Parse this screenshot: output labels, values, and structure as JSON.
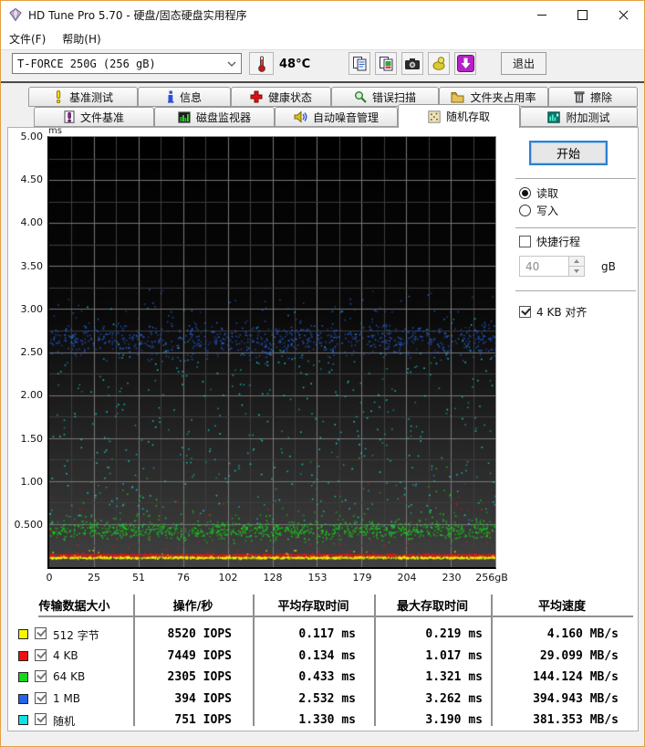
{
  "window": {
    "title": "HD Tune Pro 5.70 - 硬盘/固态硬盘实用程序"
  },
  "menu": {
    "file": "文件(F)",
    "help": "帮助(H)"
  },
  "toolbar": {
    "drive": "T-FORCE 250G (256 gB)",
    "temperature": "48°C",
    "exit": "退出"
  },
  "tabs": {
    "active": "随机存取",
    "row1": [
      {
        "label": "基准测试",
        "icon": "benchmark-icon"
      },
      {
        "label": "信息",
        "icon": "info-icon"
      },
      {
        "label": "健康状态",
        "icon": "health-icon"
      },
      {
        "label": "错误扫描",
        "icon": "error-scan-icon"
      },
      {
        "label": "文件夹占用率",
        "icon": "folder-usage-icon"
      },
      {
        "label": "擦除",
        "icon": "erase-icon"
      }
    ],
    "row2": [
      {
        "label": "文件基准",
        "icon": "file-benchmark-icon"
      },
      {
        "label": "磁盘监视器",
        "icon": "disk-monitor-icon"
      },
      {
        "label": "自动噪音管理",
        "icon": "aam-icon"
      },
      {
        "label": "随机存取",
        "icon": "random-access-icon"
      },
      {
        "label": "附加测试",
        "icon": "extra-tests-icon"
      }
    ]
  },
  "panel": {
    "start": "开始",
    "read": "读取",
    "write": "写入",
    "quick_range": "快捷行程",
    "quick_range_value": "40",
    "quick_range_unit": "gB",
    "align_4kb": "4 KB 对齐"
  },
  "chart_data": {
    "type": "scatter",
    "unit_label": "ms",
    "ylim": [
      0,
      5
    ],
    "xlim": [
      0,
      256
    ],
    "x_unit": "gB",
    "grid": "major+minor, dark background",
    "legend_position": "results-table-left-column",
    "ytick_labels": [
      "5.00",
      "4.50",
      "4.00",
      "3.50",
      "3.00",
      "2.50",
      "2.00",
      "1.50",
      "1.00",
      "0.500"
    ],
    "xtick_labels": [
      "0",
      "25",
      "51",
      "76",
      "102",
      "128",
      "153",
      "179",
      "204",
      "230",
      "256gB"
    ],
    "series": [
      {
        "name": "512 字节",
        "color": "#f6f600",
        "iops": 8520,
        "avg_ms": 0.117,
        "max_ms": 0.219,
        "speed_mbs": 4.16,
        "dist": "gauss",
        "band": [
          0.096,
          0.133
        ],
        "count": 1150,
        "outliers": {
          "range": [
            0.133,
            0.22
          ],
          "count": 25,
          "bias": 2
        }
      },
      {
        "name": "4 KB",
        "color": "#ee1212",
        "iops": 7449,
        "avg_ms": 0.134,
        "max_ms": 1.017,
        "speed_mbs": 29.099,
        "dist": "gauss",
        "band": [
          0.122,
          0.165
        ],
        "count": 1350,
        "outliers": {
          "range": [
            0.165,
            1.02
          ],
          "count": 55,
          "bias": 3
        }
      },
      {
        "name": "64 KB",
        "color": "#14d914",
        "iops": 2305,
        "avg_ms": 0.433,
        "max_ms": 1.321,
        "speed_mbs": 144.124,
        "dist": "gauss",
        "band": [
          0.27,
          0.6
        ],
        "count": 1050,
        "outliers": {
          "range": [
            0.6,
            1.32
          ],
          "count": 80,
          "bias": 2.5
        }
      },
      {
        "name": "1 MB",
        "color": "#2563e8",
        "iops": 394,
        "avg_ms": 2.532,
        "max_ms": 3.262,
        "speed_mbs": 394.943,
        "dist": "gauss",
        "band": [
          2.33,
          2.97
        ],
        "count": 850,
        "outliers": {
          "range": [
            2.97,
            3.26
          ],
          "count": 45,
          "bias": 2
        }
      },
      {
        "name": "随机",
        "color": "#12e2e2",
        "iops": 751,
        "avg_ms": 1.33,
        "max_ms": 3.19,
        "speed_mbs": 381.353,
        "dist": "uniform",
        "band": [
          0.36,
          2.52
        ],
        "count": 430,
        "outliers": {
          "range": [
            2.52,
            3.19
          ],
          "count": 28,
          "bias": 2
        }
      }
    ]
  },
  "table": {
    "headers": [
      "传输数据大小",
      "操作/秒",
      "平均存取时间",
      "最大存取时间",
      "平均速度"
    ],
    "rows": [
      {
        "color": "#f6f600",
        "label": "512 字节",
        "checked": true,
        "ops": "8520 IOPS",
        "avg": "0.117 ms",
        "max": "0.219 ms",
        "speed": "4.160 MB/s"
      },
      {
        "color": "#ee1212",
        "label": "4 KB",
        "checked": true,
        "ops": "7449 IOPS",
        "avg": "0.134 ms",
        "max": "1.017 ms",
        "speed": "29.099 MB/s"
      },
      {
        "color": "#14d914",
        "label": "64 KB",
        "checked": true,
        "ops": "2305 IOPS",
        "avg": "0.433 ms",
        "max": "1.321 ms",
        "speed": "144.124 MB/s"
      },
      {
        "color": "#2563e8",
        "label": "1 MB",
        "checked": true,
        "ops": "394 IOPS",
        "avg": "2.532 ms",
        "max": "3.262 ms",
        "speed": "394.943 MB/s"
      },
      {
        "color": "#12e2e2",
        "label": "随机",
        "checked": true,
        "ops": "751 IOPS",
        "avg": "1.330 ms",
        "max": "3.190 ms",
        "speed": "381.353 MB/s"
      }
    ]
  }
}
